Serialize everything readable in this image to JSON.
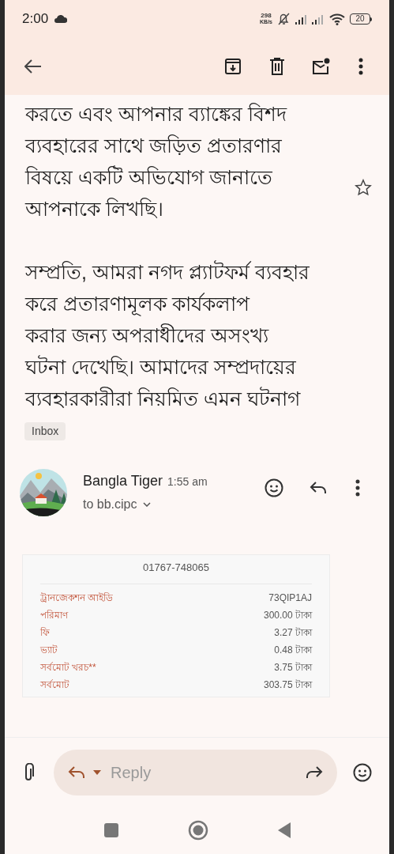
{
  "status_bar": {
    "time": "2:00",
    "net_speed": "298",
    "net_unit": "KB/s",
    "battery": "20"
  },
  "body": {
    "paragraphs": [
      [
        "করতে এবং আপনার ব্যাঙ্কের বিশদ",
        "ব্যবহারের সাথে জড়িত প্রতারণার",
        "বিষয়ে একটি অভিযোগ জানাতে",
        "আপনাকে লিখছি।"
      ],
      [
        "সম্প্রতি, আমরা নগদ প্ল্যাটফর্ম ব্যবহার",
        "করে প্রতারণামূলক কার্যকলাপ",
        "করার জন্য অপরাধীদের অসংখ্য",
        "ঘটনা দেখেছি। আমাদের সম্প্রদায়ের",
        "ব্যবহারকারীরা নিয়মিত এমন ঘটনাগ"
      ]
    ],
    "starred": false
  },
  "label": "Inbox",
  "message": {
    "sender": "Bangla Tiger",
    "time": "1:55 am",
    "recipient": "to bb.cipc"
  },
  "receipt": {
    "phone": "01767-748065",
    "rows": [
      {
        "label": "ট্রানজেকশন আইডি",
        "value": "73QIP1AJ"
      },
      {
        "label": "পরিমাণ",
        "value": "300.00 টাকা"
      },
      {
        "label": "ফি",
        "value": "3.27 টাকা"
      },
      {
        "label": "ভ্যাট",
        "value": "0.48 টাকা"
      },
      {
        "label": "সর্বমোট খরচ**",
        "value": "3.75 টাকা"
      },
      {
        "label": "সর্বমোট",
        "value": "303.75 টাকা"
      }
    ]
  },
  "reply_bar": {
    "placeholder": "Reply"
  }
}
